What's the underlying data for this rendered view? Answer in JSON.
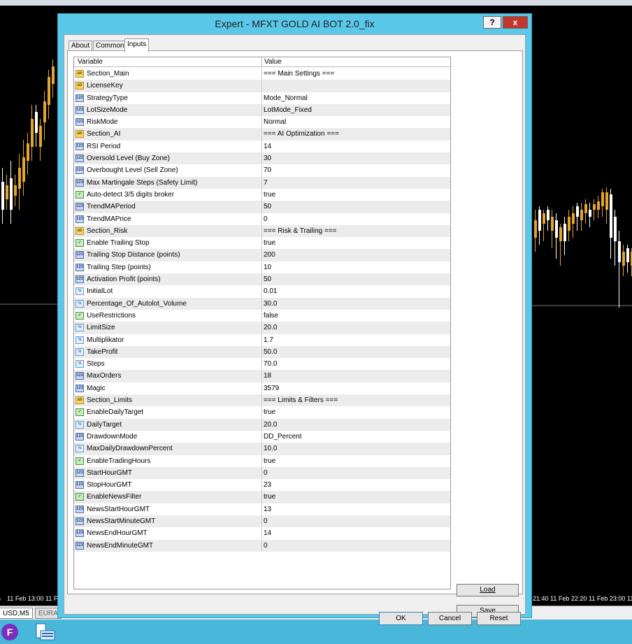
{
  "window": {
    "title": "Expert - MFXT GOLD AI BOT 2.0_fix",
    "help_label": "?",
    "close_label": "x"
  },
  "tabs": [
    {
      "label": "About"
    },
    {
      "label": "Common"
    },
    {
      "label": "Inputs"
    }
  ],
  "grid": {
    "col_variable": "Variable",
    "col_value": "Value",
    "rows": [
      {
        "type": "ab",
        "name": "Section_Main",
        "value": "=== Main Settings ==="
      },
      {
        "type": "ab",
        "name": "LicenseKey",
        "value": ""
      },
      {
        "type": "enum",
        "name": "StrategyType",
        "value": "Mode_Normal"
      },
      {
        "type": "enum",
        "name": "LotSizeMode",
        "value": "LotMode_Fixed"
      },
      {
        "type": "enum",
        "name": "RiskMode",
        "value": "Normal"
      },
      {
        "type": "ab",
        "name": "Section_AI",
        "value": "=== AI Optimization ==="
      },
      {
        "type": "int",
        "name": "RSI Period",
        "value": "14"
      },
      {
        "type": "int",
        "name": "Oversold Level (Buy Zone)",
        "value": "30"
      },
      {
        "type": "int",
        "name": "Overbought Level (Sell Zone)",
        "value": "70"
      },
      {
        "type": "int",
        "name": "Max Martingale Steps (Safety Limit)",
        "value": "7"
      },
      {
        "type": "bool",
        "name": "Auto-detect 3/5 digits broker",
        "value": "true"
      },
      {
        "type": "int",
        "name": "TrendMAPeriod",
        "value": "50"
      },
      {
        "type": "int",
        "name": "TrendMAPrice",
        "value": "0"
      },
      {
        "type": "ab",
        "name": "Section_Risk",
        "value": "=== Risk & Trailing ==="
      },
      {
        "type": "bool",
        "name": "Enable Trailing Stop",
        "value": "true"
      },
      {
        "type": "int",
        "name": "Trailing Stop Distance (points)",
        "value": "200"
      },
      {
        "type": "int",
        "name": "Trailing Step (points)",
        "value": "10"
      },
      {
        "type": "int",
        "name": "Activation Profit (points)",
        "value": "50"
      },
      {
        "type": "dbl",
        "name": "InitialLot",
        "value": "0.01"
      },
      {
        "type": "dbl",
        "name": "Percentage_Of_Autolot_Volume",
        "value": "30.0"
      },
      {
        "type": "bool",
        "name": "UseRestrictions",
        "value": "false"
      },
      {
        "type": "dbl",
        "name": "LimitSize",
        "value": "20.0"
      },
      {
        "type": "dbl",
        "name": "Multiplikator",
        "value": "1.7"
      },
      {
        "type": "dbl",
        "name": "TakeProfit",
        "value": "50.0"
      },
      {
        "type": "dbl",
        "name": "Steps",
        "value": "70.0"
      },
      {
        "type": "int",
        "name": "MaxOrders",
        "value": "18"
      },
      {
        "type": "int",
        "name": "Magic",
        "value": "3579"
      },
      {
        "type": "ab",
        "name": "Section_Limits",
        "value": "=== Limits & Filters ==="
      },
      {
        "type": "bool",
        "name": "EnableDailyTarget",
        "value": "true"
      },
      {
        "type": "dbl",
        "name": "DailyTarget",
        "value": "20.0"
      },
      {
        "type": "enum",
        "name": "DrawdownMode",
        "value": "DD_Percent"
      },
      {
        "type": "dbl",
        "name": "MaxDailyDrawdownPercent",
        "value": "10.0"
      },
      {
        "type": "bool",
        "name": "EnableTradingHours",
        "value": "true"
      },
      {
        "type": "int",
        "name": "StartHourGMT",
        "value": "0"
      },
      {
        "type": "int",
        "name": "StopHourGMT",
        "value": "23"
      },
      {
        "type": "bool",
        "name": "EnableNewsFilter",
        "value": "true"
      },
      {
        "type": "int",
        "name": "NewsStartHourGMT",
        "value": "13"
      },
      {
        "type": "int",
        "name": "NewsStartMinuteGMT",
        "value": "0"
      },
      {
        "type": "int",
        "name": "NewsEndHourGMT",
        "value": "14"
      },
      {
        "type": "int",
        "name": "NewsEndMinuteGMT",
        "value": "0"
      }
    ]
  },
  "icon_glyphs": {
    "ab": "ab",
    "int": "123",
    "enum": "123",
    "dbl": "½",
    "bool": "✓"
  },
  "buttons": {
    "load": "Load",
    "save": "Save",
    "ok": "OK",
    "cancel": "Cancel",
    "reset": "Reset"
  },
  "chart": {
    "time_labels_left": [
      "11 Feb 13:00",
      "11 F"
    ],
    "time_labels_right": [
      "21:40",
      "11 Feb 22:20",
      "11 Feb 23:00",
      "11"
    ],
    "symbol_tabs": [
      "USD,M5",
      "EURA"
    ]
  },
  "colors": {
    "dialog_frame": "#5ac8e8",
    "close_button": "#c4352d",
    "taskbar": "#49b7d9",
    "candle_up": "#e3a52b",
    "candle_down": "#ffffff"
  }
}
